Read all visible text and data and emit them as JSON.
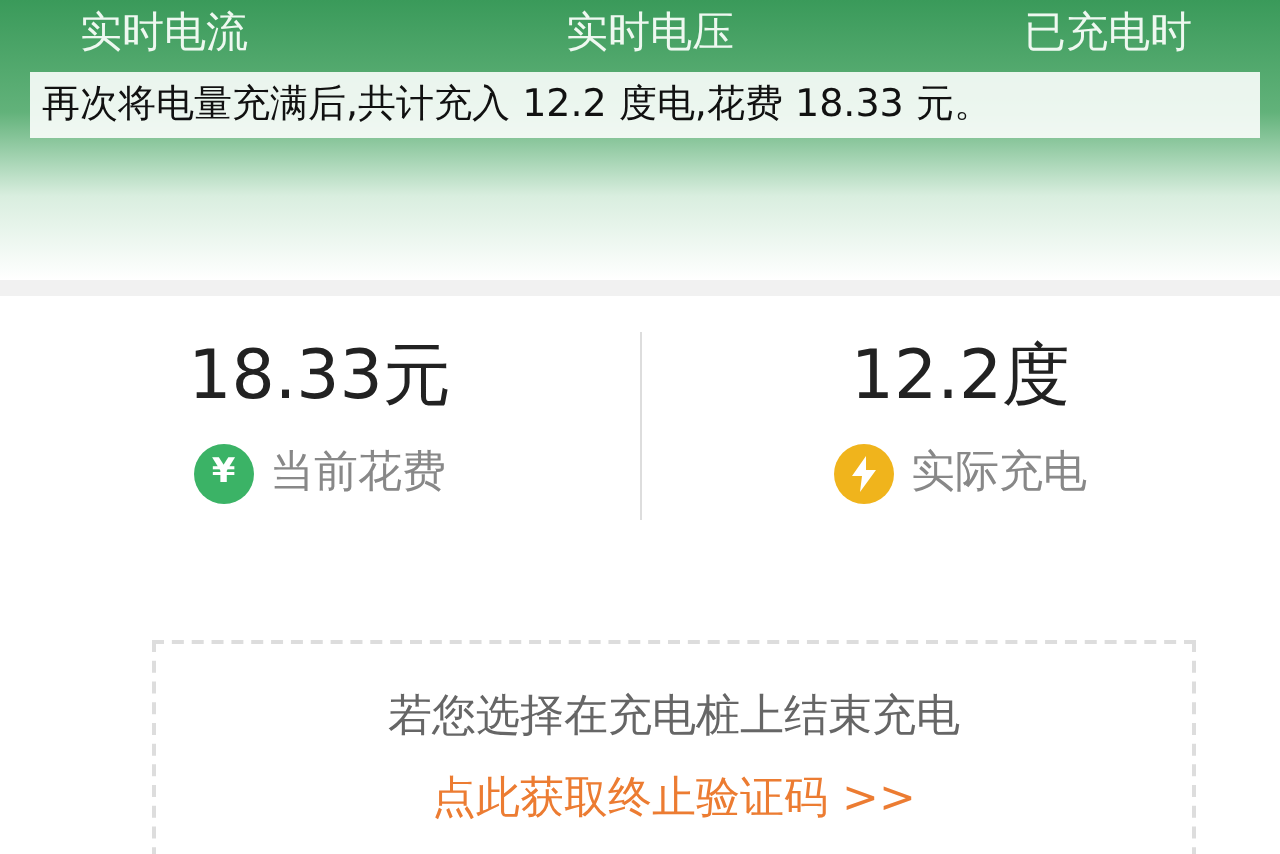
{
  "header": {
    "metrics": [
      {
        "label": "实时电流"
      },
      {
        "label": "实时电压"
      },
      {
        "label": "已充电时"
      }
    ]
  },
  "caption": "再次将电量充满后,共计充入 12.2 度电,花费 18.33 元。",
  "summary": [
    {
      "kind": "cost",
      "value": "18.33元",
      "icon": "¥",
      "label": "当前花费"
    },
    {
      "kind": "energy",
      "value": "12.2度",
      "label": "实际充电"
    }
  ],
  "stop_notice": {
    "text": "若您选择在充电桩上结束充电",
    "link": "点此获取终止验证码 >>"
  }
}
